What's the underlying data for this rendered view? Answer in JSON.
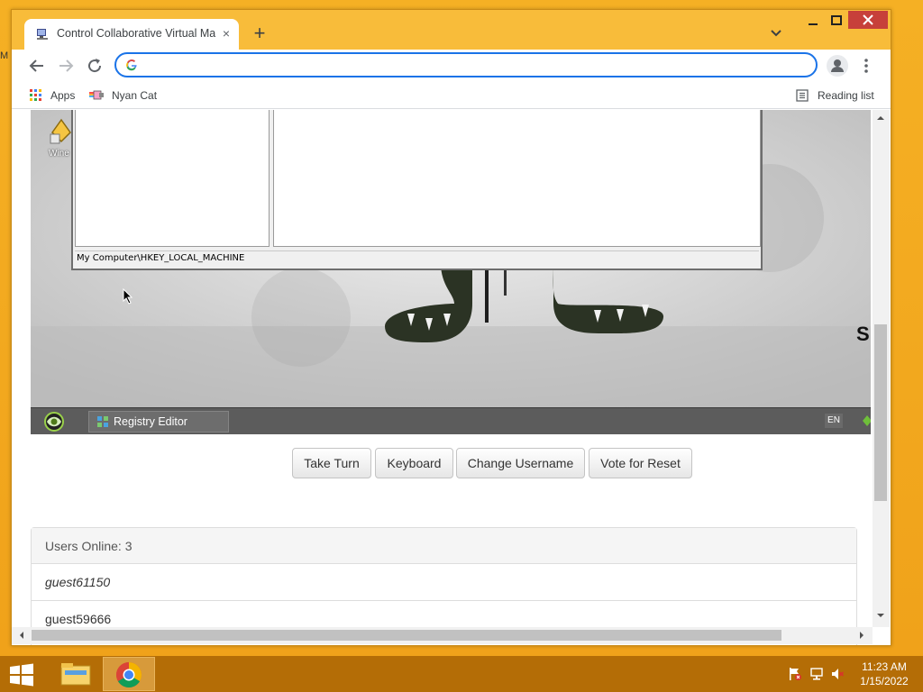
{
  "browser": {
    "tab_title": "Control Collaborative Virtual Ma",
    "tab_close": "×",
    "new_tab": "+",
    "omnibox_value": "",
    "omnibox_placeholder": ""
  },
  "bookmarks": {
    "apps_label": "Apps",
    "nyan_label": "Nyan Cat",
    "reading_list_label": "Reading list"
  },
  "vm": {
    "desktop_icon_label": "Wine",
    "regedit_status": "My Computer\\HKEY_LOCAL_MACHINE",
    "taskbar_item": "Registry Editor",
    "language": "EN",
    "edge_text": "S"
  },
  "controls": {
    "take_turn": "Take Turn",
    "keyboard": "Keyboard",
    "change_username": "Change Username",
    "vote_reset": "Vote for Reset"
  },
  "users": {
    "header": "Users Online: 3",
    "list": [
      "guest61150",
      "guest59666"
    ]
  },
  "taskbar": {
    "time": "11:23 AM",
    "date": "1/15/2022"
  },
  "colors": {
    "accent": "#1a73e8",
    "desktop": "#f2a81e",
    "window_close": "#c7403a"
  }
}
